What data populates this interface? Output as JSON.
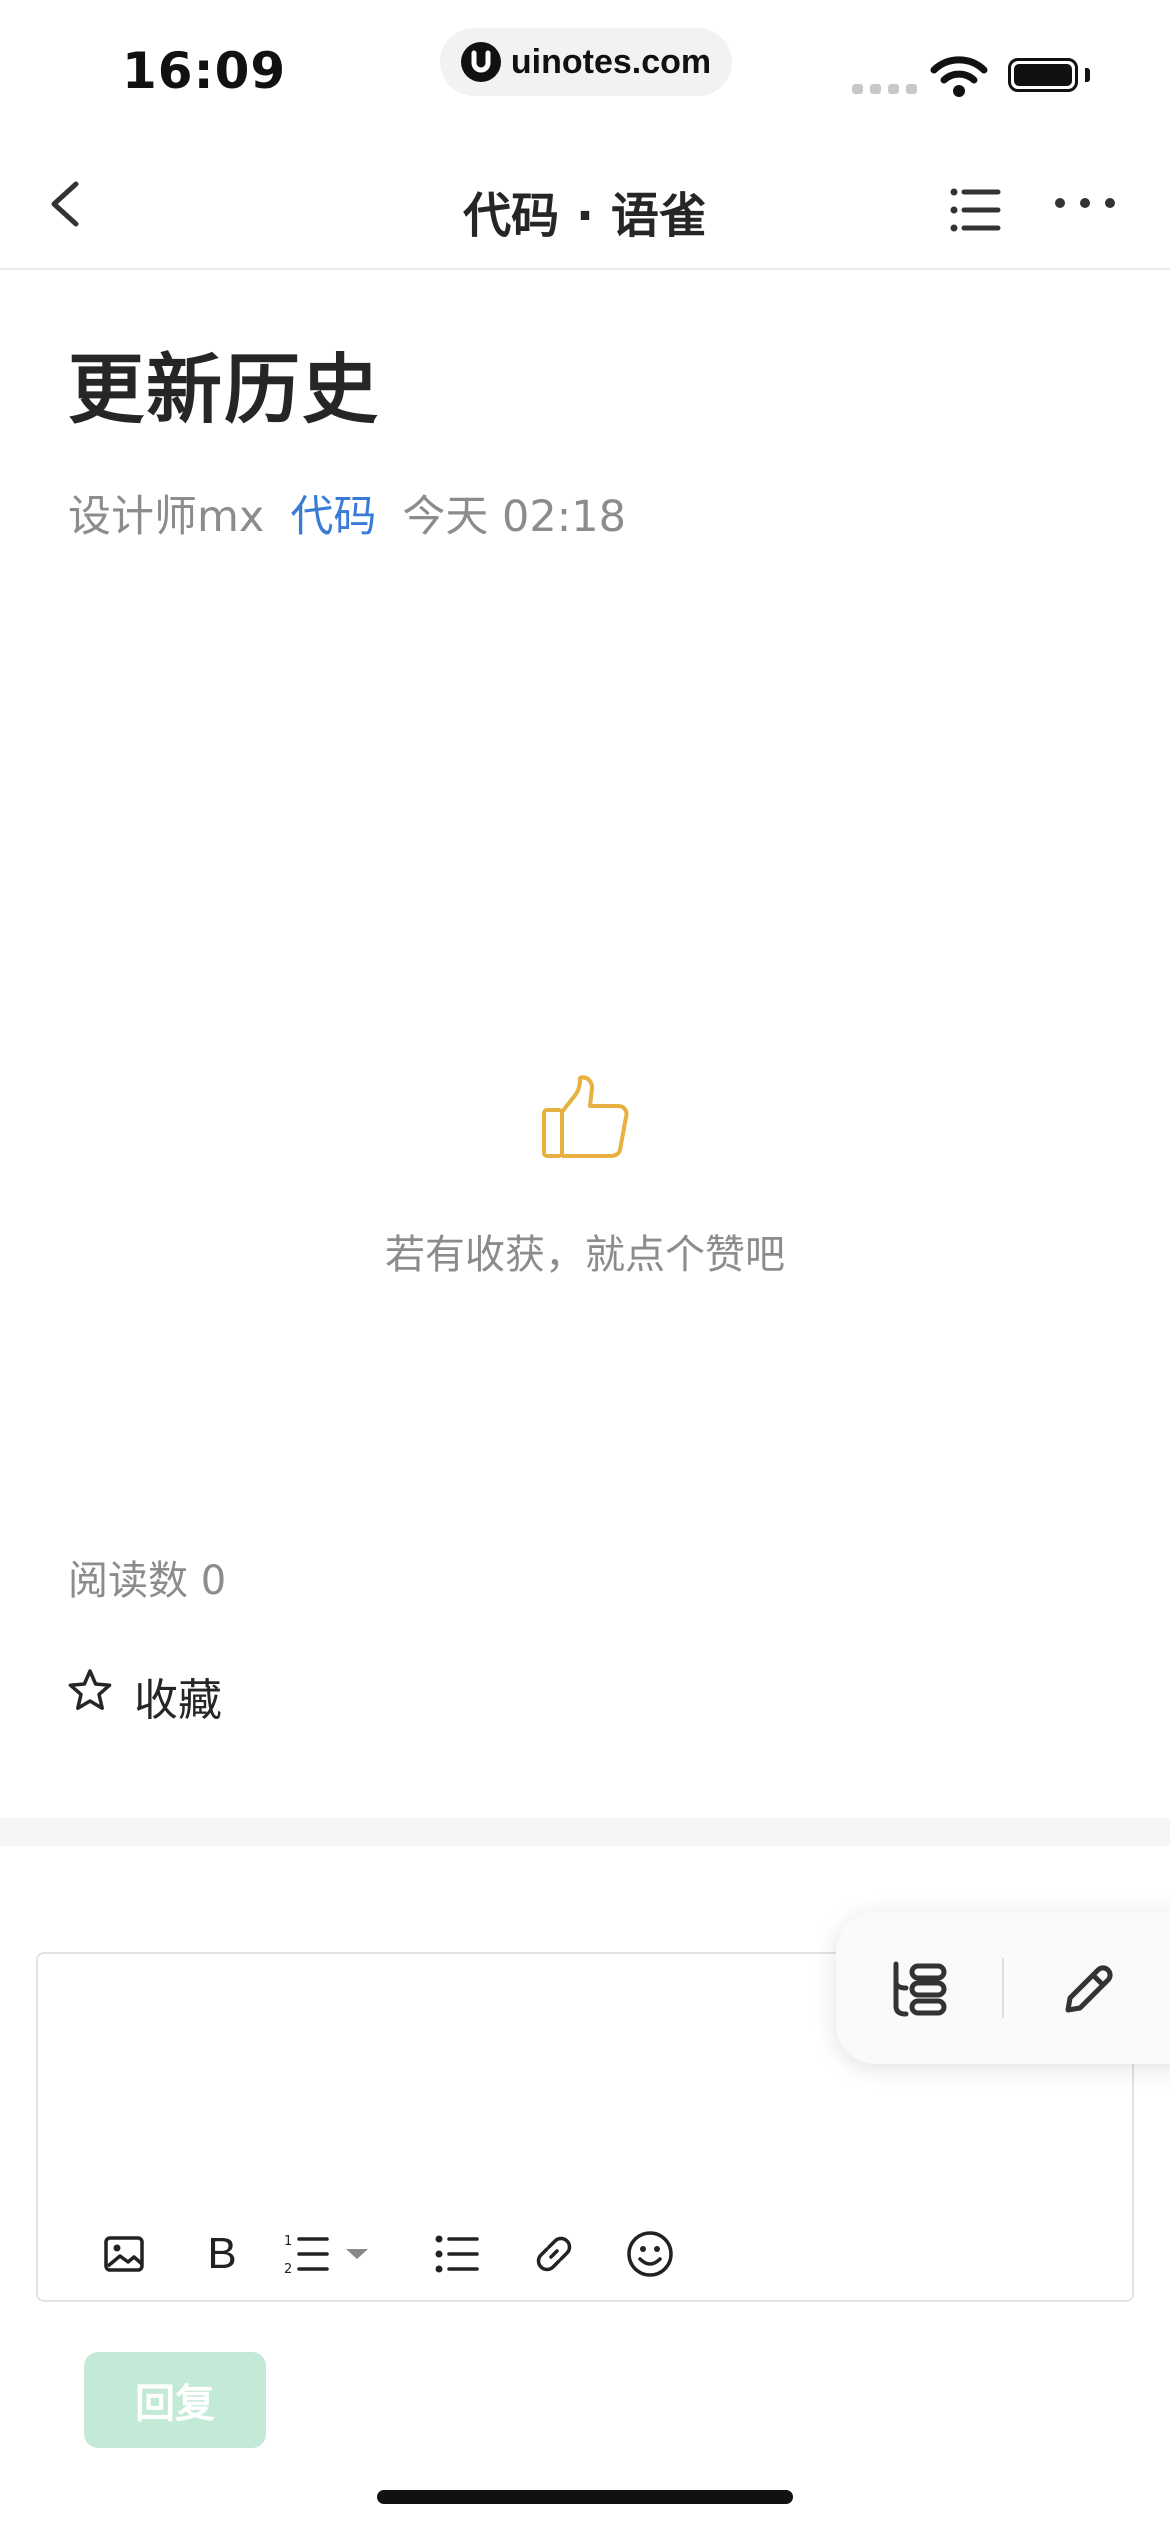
{
  "status_bar": {
    "time": "16:09",
    "url": "uinotes.com",
    "icons": [
      "cellular-signal-icon",
      "wifi-icon",
      "battery-icon"
    ]
  },
  "nav": {
    "title": "代码 · 语雀",
    "back_icon": "chevron-left-icon",
    "toc_icon": "list-icon",
    "more_icon": "more-dots-icon"
  },
  "document": {
    "title": "更新历史",
    "author": "设计师mx",
    "book": "代码",
    "updated": "今天 02:18",
    "like_icon": "thumbs-up-icon",
    "like_prompt": "若有收获，就点个赞吧",
    "read_count": "阅读数 0",
    "favorite_label": "收藏",
    "favorite_icon": "star-icon"
  },
  "floating_actions": {
    "outline_icon": "outline-tree-icon",
    "edit_icon": "pencil-icon"
  },
  "editor": {
    "toolbar_icons": [
      "image-icon",
      "bold-icon",
      "ordered-list-icon",
      "dropdown-caret-icon",
      "bullet-list-icon",
      "link-icon",
      "emoji-icon"
    ],
    "bold_glyph": "B"
  },
  "reply": {
    "label": "回复"
  },
  "colors": {
    "link_blue": "#3a7bd5",
    "thumb_orange": "#e8b040",
    "reply_disabled": "#c2ead7",
    "meta_gray": "#8c8c8c"
  }
}
